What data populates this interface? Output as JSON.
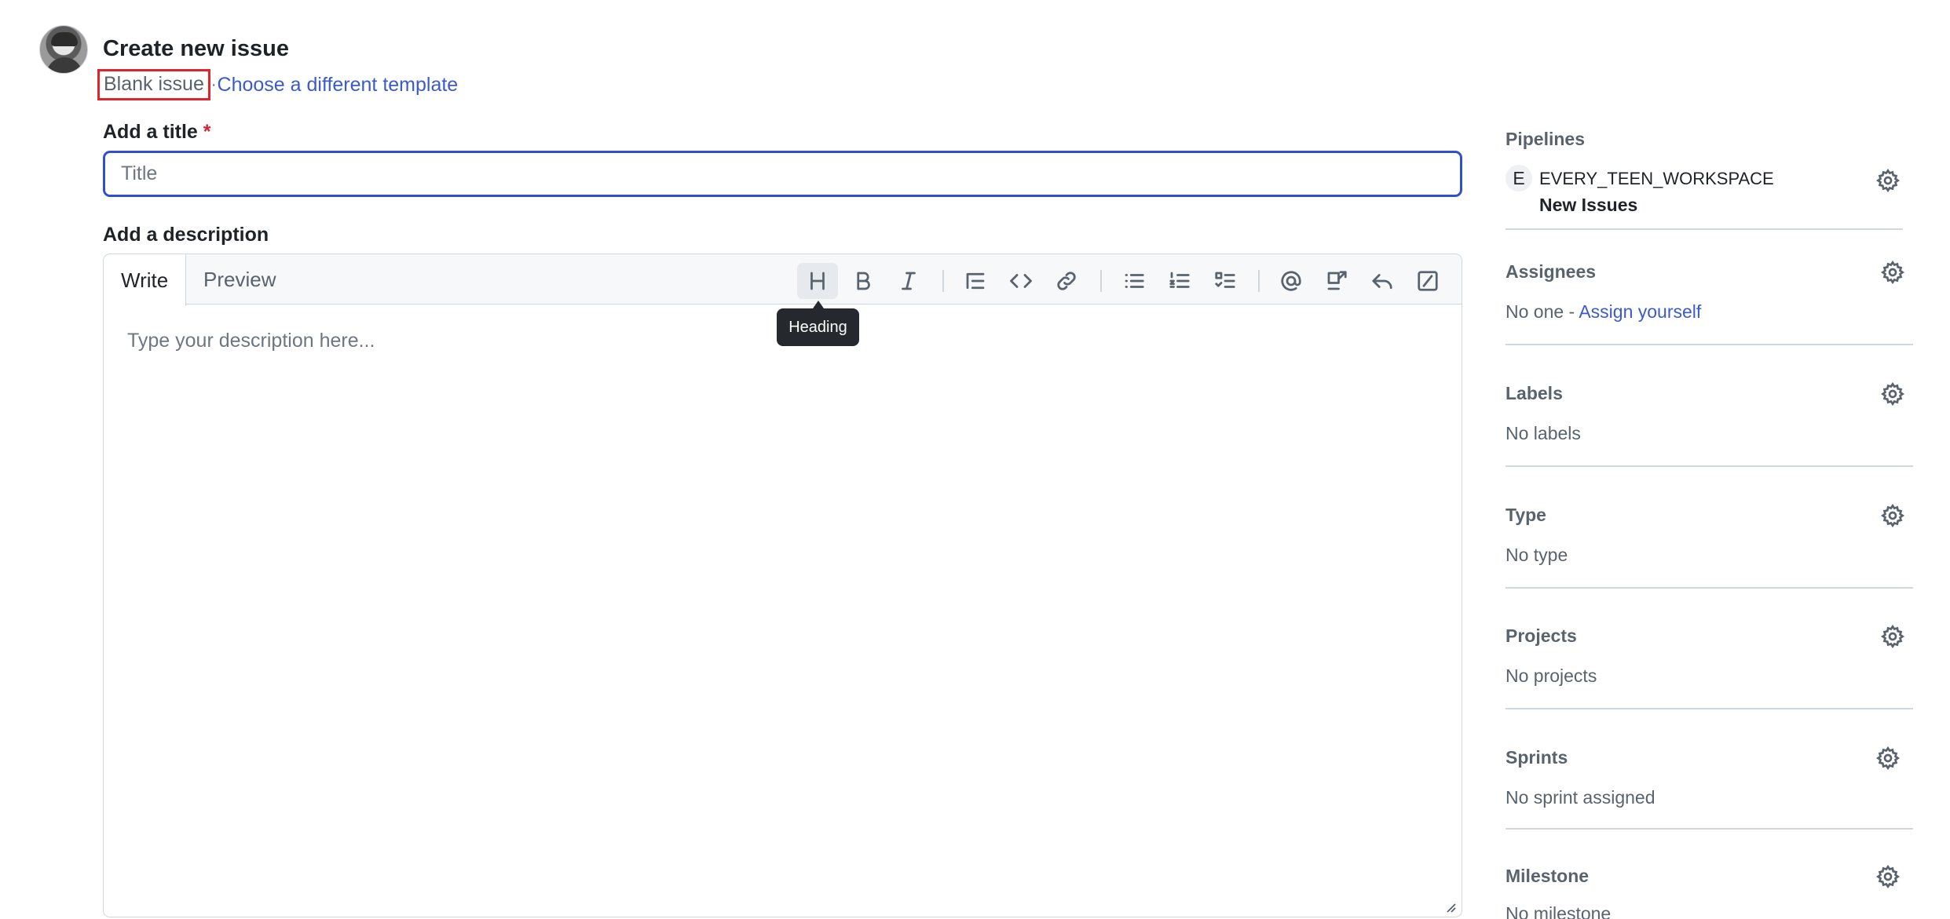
{
  "header": {
    "title": "Create new issue",
    "template_current": "Blank issue",
    "template_separator": "·",
    "template_link": "Choose a different template"
  },
  "form": {
    "title_label": "Add a title",
    "required_mark": "*",
    "title_placeholder": "Title",
    "title_value": "",
    "description_label": "Add a description",
    "description_placeholder": "Type your description here...",
    "tabs": [
      {
        "label": "Write",
        "active": true
      },
      {
        "label": "Preview",
        "active": false
      }
    ],
    "toolbar": {
      "buttons": [
        {
          "icon": "heading-icon",
          "tooltip": "Heading",
          "active": true
        },
        {
          "icon": "bold-icon"
        },
        {
          "icon": "italic-icon"
        },
        {
          "icon": "quote-icon"
        },
        {
          "icon": "code-icon"
        },
        {
          "icon": "link-icon"
        },
        {
          "icon": "unordered-list-icon"
        },
        {
          "icon": "ordered-list-icon"
        },
        {
          "icon": "task-list-icon"
        },
        {
          "icon": "mention-icon"
        },
        {
          "icon": "cross-reference-icon"
        },
        {
          "icon": "reply-icon"
        },
        {
          "icon": "slash-command-icon"
        }
      ],
      "tooltip_text": "Heading"
    }
  },
  "sidebar": {
    "pipelines": {
      "title": "Pipelines",
      "workspace_initial": "E",
      "workspace_name": "EVERY_TEEN_WORKSPACE",
      "pipeline": "New Issues"
    },
    "assignees": {
      "title": "Assignees",
      "value": "No one - ",
      "action": "Assign yourself"
    },
    "labels": {
      "title": "Labels",
      "value": "No labels"
    },
    "type": {
      "title": "Type",
      "value": "No type"
    },
    "projects": {
      "title": "Projects",
      "value": "No projects"
    },
    "sprints": {
      "title": "Sprints",
      "value": "No sprint assigned"
    },
    "milestone": {
      "title": "Milestone",
      "value": "No milestone"
    }
  },
  "colors": {
    "accent": "#3b5bcc",
    "focus_border": "#2f4fcf",
    "highlight_box": "#e0242c",
    "required": "#d1242f",
    "muted_text": "#59636e"
  }
}
